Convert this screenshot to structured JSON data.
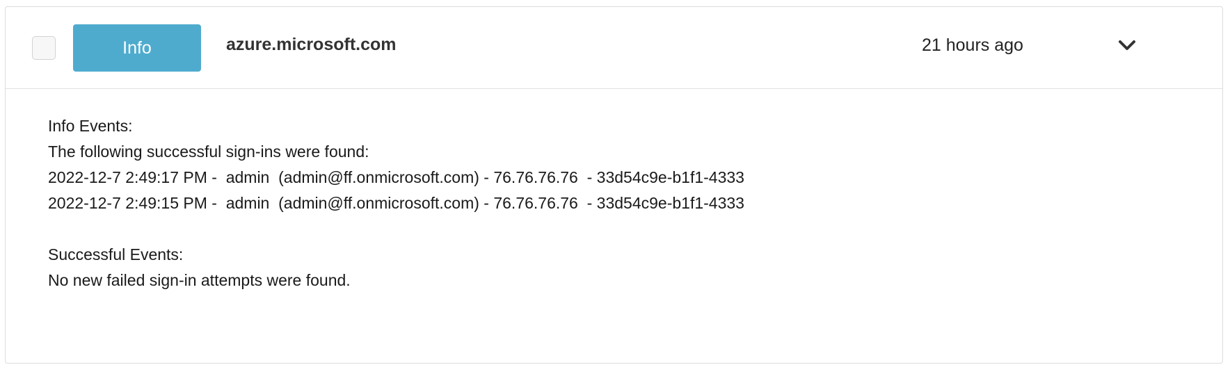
{
  "alert": {
    "badge_label": "Info",
    "domain": "azure.microsoft.com",
    "time_ago": "21 hours ago",
    "badge_color": "#4fabce",
    "expand_icon": "chevron-down-icon"
  },
  "details": {
    "info_heading": "Info Events:",
    "info_intro": "The following successful sign-ins were found:",
    "info_rows": [
      "2022-12-7 2:49:17 PM -  admin  (admin@ff.onmicrosoft.com) - 76.76.76.76  - 33d54c9e-b1f1-4333",
      "2022-12-7 2:49:15 PM -  admin  (admin@ff.onmicrosoft.com) - 76.76.76.76  - 33d54c9e-b1f1-4333"
    ],
    "success_heading": "Successful Events:",
    "success_message": "No new failed sign-in attempts were found."
  }
}
